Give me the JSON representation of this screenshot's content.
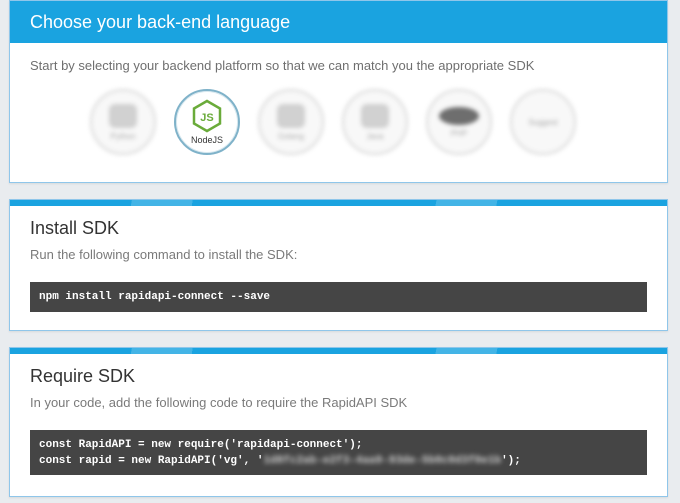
{
  "backend_card": {
    "title": "Choose your back-end language",
    "description": "Start by selecting your backend platform so that we can match you the appropriate SDK",
    "languages": [
      {
        "label": "Python",
        "icon": "python-icon",
        "selected": false
      },
      {
        "label": "NodeJS",
        "icon": "nodejs-icon",
        "selected": true
      },
      {
        "label": "Golang",
        "icon": "gopher-icon",
        "selected": false
      },
      {
        "label": "Java",
        "icon": "java-icon",
        "selected": false
      },
      {
        "label": "PHP",
        "icon": "php-icon",
        "selected": false
      },
      {
        "label": "Suggest",
        "icon": "suggest-icon",
        "selected": false
      }
    ]
  },
  "install_card": {
    "title": "Install SDK",
    "description": "Run the following command to install the SDK:",
    "command": "npm install rapidapi-connect --save"
  },
  "require_card": {
    "title": "Require SDK",
    "description": "In your code, add the following code to require the RapidAPI SDK",
    "line1": "const RapidAPI = new require('rapidapi-connect');",
    "line2_prefix": "const rapid = new RapidAPI('vg', '",
    "line2_secret": "1d8fc2ab-e2f3-4aa9-93de-5b0c0d3f0e1b",
    "line2_suffix": "');"
  },
  "colors": {
    "accent": "#1aa3e0",
    "code_bg": "#454545",
    "card_border": "#8fc6ea"
  }
}
